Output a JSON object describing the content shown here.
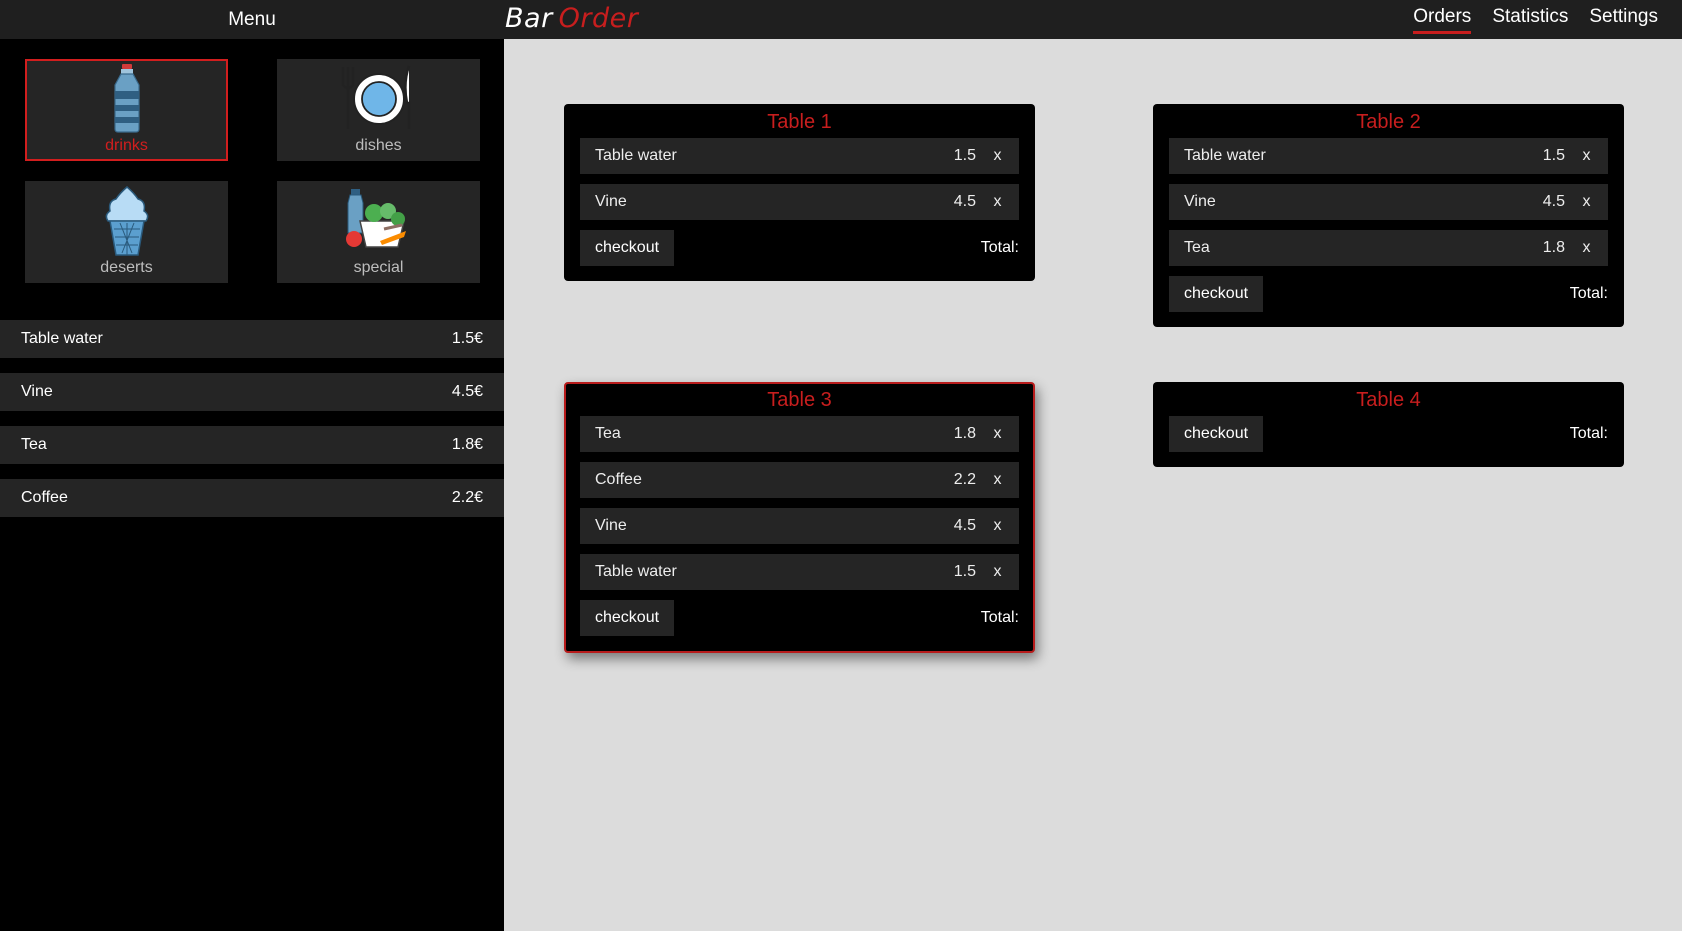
{
  "menu": {
    "title": "Menu"
  },
  "brand": {
    "part1": "Bar",
    "part2": "Order"
  },
  "nav": {
    "orders": "Orders",
    "statistics": "Statistics",
    "settings": "Settings",
    "active": "Orders"
  },
  "categories": [
    {
      "label": "drinks",
      "icon": "water-bottle-icon",
      "selected": true
    },
    {
      "label": "dishes",
      "icon": "plate-fork-knife-icon",
      "selected": false
    },
    {
      "label": "deserts",
      "icon": "ice-cream-icon",
      "selected": false
    },
    {
      "label": "special",
      "icon": "groceries-icon",
      "selected": false
    }
  ],
  "products": [
    {
      "name": "Table water",
      "price": "1.5€"
    },
    {
      "name": "Vine",
      "price": "4.5€"
    },
    {
      "name": "Tea",
      "price": "1.8€"
    },
    {
      "name": "Coffee",
      "price": "2.2€"
    }
  ],
  "tables": [
    {
      "name": "Table 1",
      "active": false,
      "items": [
        {
          "name": "Table water",
          "price": "1.5",
          "remove": "x"
        },
        {
          "name": "Vine",
          "price": "4.5",
          "remove": "x"
        }
      ],
      "checkout": "checkout",
      "total": "Total:"
    },
    {
      "name": "Table 2",
      "active": false,
      "items": [
        {
          "name": "Table water",
          "price": "1.5",
          "remove": "x"
        },
        {
          "name": "Vine",
          "price": "4.5",
          "remove": "x"
        },
        {
          "name": "Tea",
          "price": "1.8",
          "remove": "x"
        }
      ],
      "checkout": "checkout",
      "total": "Total:"
    },
    {
      "name": "Table 3",
      "active": true,
      "items": [
        {
          "name": "Tea",
          "price": "1.8",
          "remove": "x"
        },
        {
          "name": "Coffee",
          "price": "2.2",
          "remove": "x"
        },
        {
          "name": "Vine",
          "price": "4.5",
          "remove": "x"
        },
        {
          "name": "Table water",
          "price": "1.5",
          "remove": "x"
        }
      ],
      "checkout": "checkout",
      "total": "Total:"
    },
    {
      "name": "Table 4",
      "active": false,
      "items": [],
      "checkout": "checkout",
      "total": "Total:"
    }
  ],
  "colors": {
    "accent": "#c81e1e",
    "panel": "#252525",
    "background": "#dcdcdc",
    "bar": "#1f1f1f"
  }
}
